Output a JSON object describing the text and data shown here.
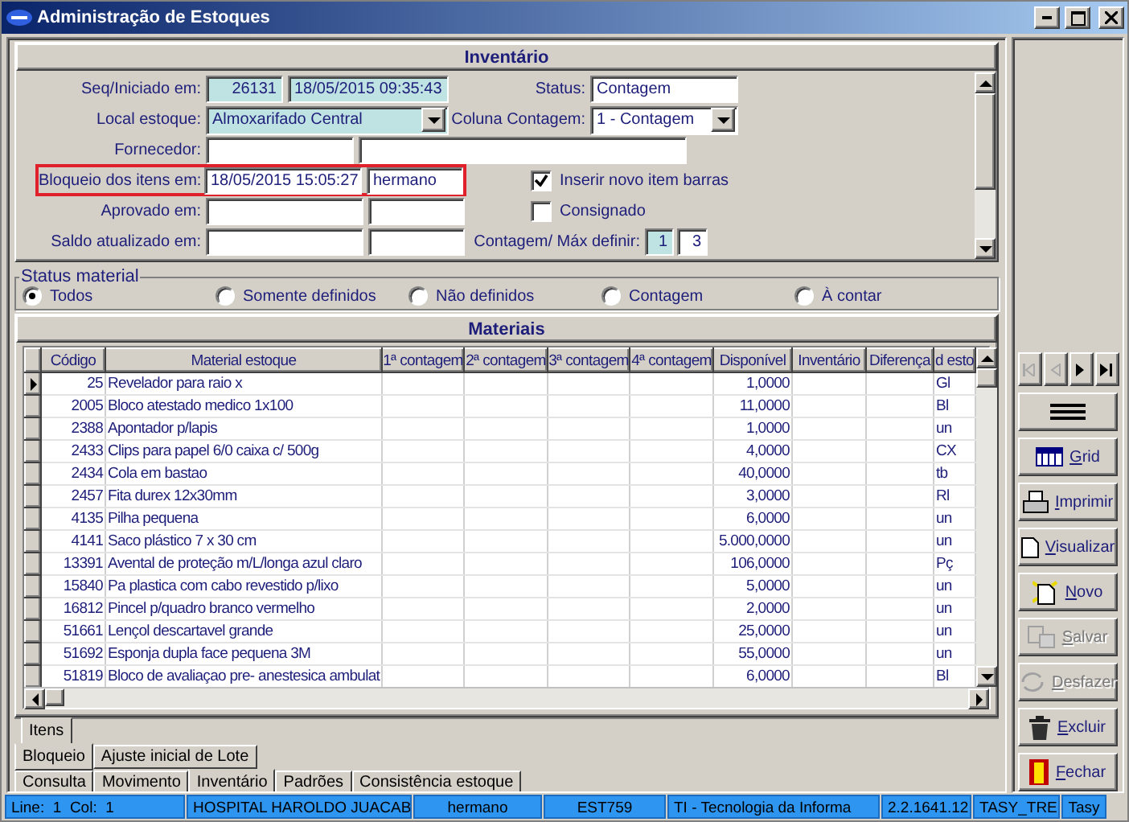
{
  "window": {
    "title": "Administração de Estoques"
  },
  "form": {
    "title": "Inventário",
    "seq_started": {
      "label": "Seq/Iniciado em:",
      "seq": "26131",
      "date": "18/05/2015 09:35:43"
    },
    "status": {
      "label": "Status:",
      "value": "Contagem"
    },
    "stock_location": {
      "label": "Local estoque:",
      "value": "Almoxarifado Central"
    },
    "count_column": {
      "label": "Coluna Contagem:",
      "value": "1 - Contagem"
    },
    "supplier": {
      "label": "Fornecedor:"
    },
    "blocked": {
      "label": "Bloqueio dos itens em:",
      "date": "18/05/2015 15:05:27",
      "user": "hermano",
      "highlighted": true
    },
    "approved": {
      "label": "Aprovado em:"
    },
    "balance_updated": {
      "label": "Saldo atualizado em:"
    },
    "checkboxes": [
      {
        "label": "Inserir novo item barras",
        "checked": true
      },
      {
        "label": "Consignado",
        "checked": false
      }
    ],
    "count_max": {
      "label": "Contagem/ Máx definir:",
      "count": "1",
      "max": "3"
    }
  },
  "status_material": {
    "legend": "Status material",
    "options": [
      {
        "label": "Todos",
        "selected": true
      },
      {
        "label": "Somente definidos",
        "selected": false
      },
      {
        "label": "Não definidos",
        "selected": false
      },
      {
        "label": "Contagem",
        "selected": false
      },
      {
        "label": "À contar",
        "selected": false
      }
    ]
  },
  "materials": {
    "title": "Materiais",
    "columns": [
      "Código",
      "Material estoque",
      "1ª contagem",
      "2ª contagem",
      "3ª contagem",
      "4ª contagem",
      "Disponível",
      "Inventário",
      "Diferença",
      "d esto"
    ],
    "rows": [
      {
        "code": "25",
        "material": "Revelador para raio x",
        "available": "1,0000",
        "unit": "Gl",
        "selected": true
      },
      {
        "code": "2005",
        "material": "Bloco atestado medico 1x100",
        "available": "11,0000",
        "unit": "Bl",
        "selected": false
      },
      {
        "code": "2388",
        "material": "Apontador p/lapis",
        "available": "1,0000",
        "unit": "un",
        "selected": false
      },
      {
        "code": "2433",
        "material": "Clips para papel 6/0 caixa c/ 500g",
        "available": "4,0000",
        "unit": "CX",
        "selected": false
      },
      {
        "code": "2434",
        "material": "Cola em bastao",
        "available": "40,0000",
        "unit": "tb",
        "selected": false
      },
      {
        "code": "2457",
        "material": "Fita durex 12x30mm",
        "available": "3,0000",
        "unit": "Rl",
        "selected": false
      },
      {
        "code": "4135",
        "material": "Pilha pequena",
        "available": "6,0000",
        "unit": "un",
        "selected": false
      },
      {
        "code": "4141",
        "material": "Saco plástico 7 x 30 cm",
        "available": "5.000,0000",
        "unit": "un",
        "selected": false
      },
      {
        "code": "13391",
        "material": "Avental de proteção m/L/longa azul claro",
        "available": "106,0000",
        "unit": "Pç",
        "selected": false
      },
      {
        "code": "15840",
        "material": "Pa plastica com cabo revestido p/lixo",
        "available": "5,0000",
        "unit": "un",
        "selected": false
      },
      {
        "code": "16812",
        "material": "Pincel p/quadro branco  vermelho",
        "available": "2,0000",
        "unit": "un",
        "selected": false
      },
      {
        "code": "51661",
        "material": "Lençol descartavel grande",
        "available": "25,0000",
        "unit": "un",
        "selected": false
      },
      {
        "code": "51692",
        "material": "Esponja dupla face pequena 3M",
        "available": "55,0000",
        "unit": "un",
        "selected": false
      },
      {
        "code": "51819",
        "material": "Bloco de avaliaçao pre- anestesica ambulat",
        "available": "6,0000",
        "unit": "Bl",
        "selected": false
      }
    ]
  },
  "inner_tabs": [
    {
      "label": "Itens",
      "selected": true
    }
  ],
  "middle_tabs": [
    {
      "label": "Bloqueio",
      "selected": true
    },
    {
      "label": "Ajuste inicial de Lote",
      "selected": false
    }
  ],
  "main_tabs": [
    {
      "label": "Consulta",
      "selected": false
    },
    {
      "label": "Movimento",
      "selected": false
    },
    {
      "label": "Inventário",
      "selected": true
    },
    {
      "label": "Padrões",
      "selected": false
    },
    {
      "label": "Consistência estoque",
      "selected": false
    }
  ],
  "toolbar": {
    "nav": [
      {
        "kind": "first",
        "disabled": true
      },
      {
        "kind": "prev",
        "disabled": true
      },
      {
        "kind": "next",
        "disabled": false
      },
      {
        "kind": "last",
        "disabled": false
      }
    ],
    "buttons": [
      {
        "kind": "menu",
        "disabled": false
      },
      {
        "kind": "grid",
        "label": "Grid",
        "disabled": false
      },
      {
        "kind": "print",
        "label": "Imprimir",
        "disabled": false
      },
      {
        "kind": "view",
        "label": "Visualizar",
        "disabled": false
      },
      {
        "kind": "new",
        "label": "Novo",
        "disabled": false
      },
      {
        "kind": "save",
        "label": "Salvar",
        "disabled": true
      },
      {
        "kind": "undo",
        "label": "Desfazer",
        "disabled": true
      },
      {
        "kind": "delete",
        "label": "Excluir",
        "disabled": false
      },
      {
        "kind": "close",
        "label": "Fechar",
        "disabled": false
      }
    ]
  },
  "status_bar": [
    "Line:  1  Col:  1",
    "HOSPITAL HAROLDO JUACAB",
    "hermano",
    "EST759",
    "TI - Tecnologia da Informa",
    "2.2.1641.12",
    "TASY_TRE",
    "Tasy"
  ]
}
